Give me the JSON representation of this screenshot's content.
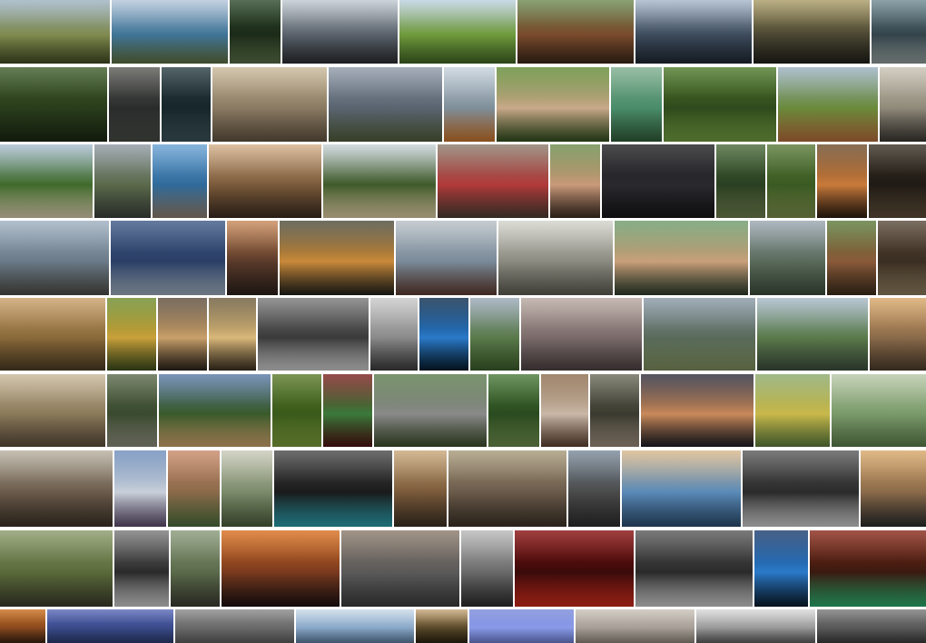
{
  "rows": [
    [
      {
        "name": "photo-stone-monument-meadow",
        "c": [
          "#9db2c2",
          "#7f8a4e",
          "#3f4a22"
        ]
      },
      {
        "name": "photo-lake-view-town",
        "c": [
          "#b3c6d9",
          "#3f7497",
          "#5a6b3e"
        ]
      },
      {
        "name": "photo-forest-road",
        "c": [
          "#2e4a2c",
          "#1c2a18",
          "#556b44"
        ]
      },
      {
        "name": "photo-coast-cliff-dusk",
        "c": [
          "#bfc8cf",
          "#59616a",
          "#2a2d30"
        ]
      },
      {
        "name": "photo-green-field-cows",
        "c": [
          "#bcd0df",
          "#6f9a3b",
          "#3f6224"
        ]
      },
      {
        "name": "photo-giant-redwood-tree",
        "c": [
          "#6b8a52",
          "#7a4a2c",
          "#3a2618"
        ]
      },
      {
        "name": "photo-snowy-mountain-lake",
        "c": [
          "#a5b6c9",
          "#3d4b5c",
          "#1e2630"
        ]
      },
      {
        "name": "photo-storm-clouds-sunbeam",
        "c": [
          "#a99b66",
          "#4a4632",
          "#1f1f1a"
        ]
      },
      {
        "name": "photo-river-rocks-seal",
        "c": [
          "#6f8a92",
          "#33434a",
          "#8f9a98"
        ]
      }
    ],
    [
      {
        "name": "photo-mossy-forest-trunks",
        "c": [
          "#3f5e2a",
          "#2a3d1c",
          "#1a2612"
        ]
      },
      {
        "name": "photo-person-misty-woods",
        "c": [
          "#5a5a56",
          "#2a2c2c",
          "#454842"
        ]
      },
      {
        "name": "photo-tall-pine-trees",
        "c": [
          "#2a3e44",
          "#17262a",
          "#3a5056"
        ]
      },
      {
        "name": "photo-sheep-flock-field",
        "c": [
          "#c9b99a",
          "#8a7a62",
          "#5f5140"
        ]
      },
      {
        "name": "photo-cloudy-plain-horizon",
        "c": [
          "#8f9aa8",
          "#5a6470",
          "#4e5a3a"
        ]
      },
      {
        "name": "photo-snow-peaks-autumn",
        "c": [
          "#c7d2dc",
          "#7e8f9a",
          "#c2702a"
        ]
      },
      {
        "name": "photo-friends-in-garden",
        "c": [
          "#5f8a33",
          "#c9a98a",
          "#2f4a1c"
        ]
      },
      {
        "name": "photo-coastal-green-bay",
        "c": [
          "#7fae8f",
          "#4a8c6a",
          "#2f5a36"
        ]
      },
      {
        "name": "photo-jungle-hut",
        "c": [
          "#4f7a2a",
          "#2f4a1c",
          "#6f9a3f"
        ]
      },
      {
        "name": "photo-hillside-path",
        "c": [
          "#9ab0c0",
          "#6a8a3a",
          "#b06a3a"
        ]
      },
      {
        "name": "photo-beach-sunset-person",
        "c": [
          "#c9c2b3",
          "#8f8a7a",
          "#3a3530"
        ]
      }
    ],
    [
      {
        "name": "photo-green-dunes-beach",
        "c": [
          "#a9bfd1",
          "#3f6a2a",
          "#d3c9a8"
        ]
      },
      {
        "name": "photo-cliff-coastline",
        "c": [
          "#8f9aa3",
          "#5a6a4a",
          "#3a3f3a"
        ]
      },
      {
        "name": "photo-rocky-sea-cliff",
        "c": [
          "#6aa3d4",
          "#2f6a9a",
          "#8a7a6a"
        ]
      },
      {
        "name": "photo-woman-smiling-coast",
        "c": [
          "#d3b08a",
          "#7a5a3a",
          "#3a2a1f"
        ]
      },
      {
        "name": "photo-beach-forest-shore",
        "c": [
          "#c9d3d9",
          "#3f5a2a",
          "#d9c9a0"
        ]
      },
      {
        "name": "photo-red-scarf-portrait",
        "c": [
          "#8a7a6a",
          "#b03a3a",
          "#4a3a30"
        ]
      },
      {
        "name": "photo-woman-portrait-green",
        "c": [
          "#6a8a4a",
          "#c99a7a",
          "#3a2a1f"
        ]
      },
      {
        "name": "photo-starry-night-sky",
        "c": [
          "#1f1f22",
          "#2a2a2e",
          "#141416"
        ]
      },
      {
        "name": "photo-forest-trail",
        "c": [
          "#4a6a3a",
          "#2a3f22",
          "#6a7a4a"
        ]
      },
      {
        "name": "photo-bamboo-grove",
        "c": [
          "#5a7a3a",
          "#3a5a22",
          "#7a8a4a"
        ]
      },
      {
        "name": "photo-plated-dessert",
        "c": [
          "#6a4a2a",
          "#c97a3a",
          "#2a1a10"
        ]
      },
      {
        "name": "photo-dark-interior-person",
        "c": [
          "#3a3226",
          "#1f1a14",
          "#5a4a36"
        ]
      }
    ],
    [
      {
        "name": "photo-rainbow-stone-wall",
        "c": [
          "#9fb0c0",
          "#6a7a88",
          "#4a4a44"
        ]
      },
      {
        "name": "photo-power-lines-sky",
        "c": [
          "#3f5a86",
          "#2a3f66",
          "#9aa8b8"
        ]
      },
      {
        "name": "photo-cafe-window",
        "c": [
          "#c98a5a",
          "#5a3a2a",
          "#2a1f1a"
        ]
      },
      {
        "name": "photo-sunset-city-buildings",
        "c": [
          "#4a4a3a",
          "#c98a3a",
          "#1f1f1a"
        ]
      },
      {
        "name": "photo-mountain-marsh",
        "c": [
          "#b8c0c6",
          "#7a8a9a",
          "#5a3a2f"
        ]
      },
      {
        "name": "photo-room-window-laptop",
        "c": [
          "#d3d3cc",
          "#8a8a80",
          "#5a5a50"
        ]
      },
      {
        "name": "photo-woman-glasses-portrait",
        "c": [
          "#6a9a6a",
          "#c9a07a",
          "#2a3a2a"
        ]
      },
      {
        "name": "photo-mountain-ridge-valley",
        "c": [
          "#9aa6b0",
          "#5a6a5a",
          "#3a4a3a"
        ]
      },
      {
        "name": "photo-mossy-tree-trunk",
        "c": [
          "#5a7a3a",
          "#8a5a3a",
          "#3a2a1a"
        ]
      },
      {
        "name": "photo-wooden-bridge",
        "c": [
          "#5a4a3a",
          "#3a2e22",
          "#8a7a5a"
        ]
      }
    ],
    [
      {
        "name": "photo-cathedral-ceiling-warm",
        "c": [
          "#c9a06a",
          "#8a6a3a",
          "#4a3a22"
        ]
      },
      {
        "name": "photo-stained-glass-green",
        "c": [
          "#6a8a2a",
          "#c9a03a",
          "#3a4a1a"
        ]
      },
      {
        "name": "photo-gothic-columns",
        "c": [
          "#5a4a3a",
          "#c9a06a",
          "#2a2219"
        ]
      },
      {
        "name": "photo-cathedral-vault-gold",
        "c": [
          "#6a5a3a",
          "#d9b87a",
          "#3a2e1f"
        ]
      },
      {
        "name": "photo-vault-ceiling-bw",
        "c": [
          "#7a7a7a",
          "#3a3a3a",
          "#c9c9c9"
        ]
      },
      {
        "name": "photo-dome-building-sky",
        "c": [
          "#c9c9c9",
          "#8a8a8a",
          "#3a3a3a"
        ]
      },
      {
        "name": "photo-blue-jellyfish",
        "c": [
          "#0a2a4a",
          "#2a7ac9",
          "#051a2a"
        ]
      },
      {
        "name": "photo-green-mountain-valley",
        "c": [
          "#9aa8b8",
          "#5a7a4a",
          "#3a5a2a"
        ]
      },
      {
        "name": "photo-hazy-mountains",
        "c": [
          "#b8a8a0",
          "#7a6a6a",
          "#4a4040"
        ]
      },
      {
        "name": "photo-valley-cliffs",
        "c": [
          "#8a9aa8",
          "#5a6a5a",
          "#7a8a5a"
        ]
      },
      {
        "name": "photo-mountain-chalet",
        "c": [
          "#a8bac8",
          "#5a7a4a",
          "#3a4a3a"
        ]
      },
      {
        "name": "photo-sunset-dunes",
        "c": [
          "#d9a86a",
          "#8a6a4a",
          "#4a3a2a"
        ]
      }
    ],
    [
      {
        "name": "photo-old-buildings-street",
        "c": [
          "#c9b89a",
          "#8a7a5a",
          "#5a4a3a"
        ]
      },
      {
        "name": "photo-waterfall-rocks",
        "c": [
          "#5a6a4a",
          "#3a4a2f",
          "#8a8a7a"
        ]
      },
      {
        "name": "photo-camping-tents",
        "c": [
          "#5a7aa8",
          "#3a5a2a",
          "#c9a06a"
        ]
      },
      {
        "name": "photo-green-bush",
        "c": [
          "#5a7a2a",
          "#3a5a1a",
          "#7a9a3a"
        ]
      },
      {
        "name": "photo-leaf-red-background",
        "c": [
          "#7a1f1f",
          "#3a7a3a",
          "#4a1010"
        ]
      },
      {
        "name": "photo-festival-tents-smoke",
        "c": [
          "#5a7a4a",
          "#8a8a8a",
          "#3a4a2a"
        ]
      },
      {
        "name": "photo-green-foliage-path",
        "c": [
          "#4a7a3a",
          "#2a4a1f",
          "#6a8a4a"
        ]
      },
      {
        "name": "photo-shell-stones",
        "c": [
          "#8a6a4a",
          "#c9b8a8",
          "#5a4030"
        ]
      },
      {
        "name": "photo-smoke-campfire",
        "c": [
          "#6a6a5a",
          "#3a3a30",
          "#9a8a7a"
        ]
      },
      {
        "name": "photo-profile-bokeh",
        "c": [
          "#2a2a3a",
          "#c98a5a",
          "#1a1a22"
        ]
      },
      {
        "name": "photo-green-tiled-wall",
        "c": [
          "#8aa86a",
          "#c9b84a",
          "#5a7a3a"
        ]
      },
      {
        "name": "photo-pale-green-road",
        "c": [
          "#b8c8a8",
          "#7a9a6a",
          "#5a7a4a"
        ]
      }
    ],
    [
      {
        "name": "photo-hikers-mountain-view",
        "c": [
          "#b8b0a0",
          "#6a5a4a",
          "#3a3026"
        ]
      },
      {
        "name": "photo-snowy-peak-valley",
        "c": [
          "#6a8ab8",
          "#c9d0d9",
          "#5a4a6a"
        ]
      },
      {
        "name": "photo-flowers-alley",
        "c": [
          "#c98a6a",
          "#8a6a4a",
          "#4a6a3a"
        ]
      },
      {
        "name": "photo-canyon-river",
        "c": [
          "#c9c9b8",
          "#7a8a6a",
          "#4a5a3a"
        ]
      },
      {
        "name": "photo-dark-wall-pool",
        "c": [
          "#4a4a4a",
          "#1a1a1a",
          "#2a9aa8"
        ]
      },
      {
        "name": "photo-clock-tower-street",
        "c": [
          "#c9a87a",
          "#7a5a3a",
          "#3a2e22"
        ]
      },
      {
        "name": "photo-narrow-village-street",
        "c": [
          "#a89a7a",
          "#6a5a4a",
          "#3a3026"
        ]
      },
      {
        "name": "photo-alley-houses-blue",
        "c": [
          "#7a8a9a",
          "#4a4a4a",
          "#2a2a2a"
        ]
      },
      {
        "name": "photo-cumulus-clouds-sea",
        "c": [
          "#d9b88a",
          "#5a8ab8",
          "#2a4a6a"
        ]
      },
      {
        "name": "photo-night-street-lights",
        "c": [
          "#5a5a5a",
          "#2a2a2a",
          "#c9c9c9"
        ]
      },
      {
        "name": "photo-people-sunset-shore",
        "c": [
          "#d9a86a",
          "#8a6a4a",
          "#2a2a2a"
        ]
      }
    ],
    [
      {
        "name": "photo-plaza-tree-cafe",
        "c": [
          "#8a9a6a",
          "#5a6a3a",
          "#3a3a2a"
        ]
      },
      {
        "name": "photo-arched-corridor",
        "c": [
          "#7a7a7a",
          "#2a2a2a",
          "#c9c9c9"
        ]
      },
      {
        "name": "photo-narrow-lane-green",
        "c": [
          "#8a9a7a",
          "#5a6a4a",
          "#3a3a30"
        ]
      },
      {
        "name": "photo-orange-sunset-coast",
        "c": [
          "#d9701f",
          "#7a3a1f",
          "#1a1010"
        ]
      },
      {
        "name": "photo-city-coast-aerial",
        "c": [
          "#8a7a6a",
          "#5a5a5a",
          "#3a3a3a"
        ]
      },
      {
        "name": "photo-woman-eyes-closed",
        "c": [
          "#b8b8b8",
          "#6a6a6a",
          "#2a2a2a"
        ]
      },
      {
        "name": "photo-red-lamp-night",
        "c": [
          "#8a1010",
          "#3a0a0a",
          "#c92a1a"
        ]
      },
      {
        "name": "photo-flower-dark-crowd",
        "c": [
          "#5a5a5a",
          "#2a2a2a",
          "#c9c9c9"
        ]
      },
      {
        "name": "photo-glowing-lights-person",
        "c": [
          "#1a3a6a",
          "#2a7ac9",
          "#0a1a2a"
        ]
      },
      {
        "name": "photo-red-cave-lanterns",
        "c": [
          "#8a2a1a",
          "#3a1a10",
          "#2aa86a"
        ]
      }
    ],
    [
      {
        "name": "photo-orange-dusk-thumb",
        "c": [
          "#c9701f",
          "#8a4a1f",
          "#3a2010"
        ]
      },
      {
        "name": "photo-blue-mountains-dusk",
        "c": [
          "#5a6ab8",
          "#3a4a8a",
          "#2a3a6a"
        ]
      },
      {
        "name": "photo-grey-fog",
        "c": [
          "#8a8a8a",
          "#6a6a6a",
          "#5a5a5a"
        ]
      },
      {
        "name": "photo-misty-mountains",
        "c": [
          "#c9d9e8",
          "#8aa8c8",
          "#5a7a9a"
        ]
      },
      {
        "name": "photo-doorway-light",
        "c": [
          "#c9a87a",
          "#5a4a2a",
          "#2a2010"
        ]
      },
      {
        "name": "photo-blue-hazy-sky",
        "c": [
          "#7a8ad9",
          "#8a9ae8",
          "#6a7ac9"
        ]
      },
      {
        "name": "photo-foggy-hills",
        "c": [
          "#c9c2b8",
          "#a8a098",
          "#8a8278"
        ]
      },
      {
        "name": "photo-snow-mountain-bw",
        "c": [
          "#d9d9d9",
          "#9a9a9a",
          "#5a5a5a"
        ]
      },
      {
        "name": "photo-grey-rock-texture",
        "c": [
          "#7a7a7a",
          "#5a5a5a",
          "#3a3a3a"
        ]
      }
    ]
  ]
}
